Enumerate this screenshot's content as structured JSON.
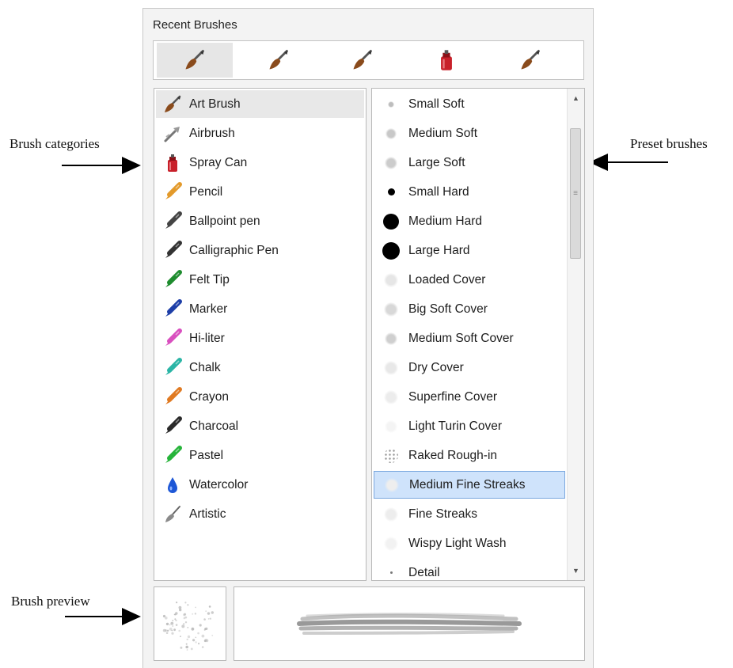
{
  "annotations": {
    "categories": "Brush categories",
    "presets": "Preset brushes",
    "preview": "Brush preview"
  },
  "recent": {
    "title": "Recent Brushes",
    "items": [
      {
        "icon": "art-brush-icon",
        "active": true
      },
      {
        "icon": "art-brush-icon"
      },
      {
        "icon": "art-brush-icon"
      },
      {
        "icon": "spray-can-icon"
      },
      {
        "icon": "art-brush-icon"
      }
    ]
  },
  "categories": {
    "selected": "Art Brush",
    "items": [
      {
        "label": "Art Brush",
        "icon": "art-brush-icon",
        "color": "#8a4b1c"
      },
      {
        "label": "Airbrush",
        "icon": "airbrush-icon",
        "color": "#777777"
      },
      {
        "label": "Spray Can",
        "icon": "spray-can-icon",
        "color": "#c8202a"
      },
      {
        "label": "Pencil",
        "icon": "pencil-icon",
        "color": "#e39a2b"
      },
      {
        "label": "Ballpoint pen",
        "icon": "ballpoint-pen-icon",
        "color": "#444444"
      },
      {
        "label": "Calligraphic Pen",
        "icon": "calligraphic-pen-icon",
        "color": "#333333"
      },
      {
        "label": "Felt Tip",
        "icon": "felt-tip-icon",
        "color": "#1e8c2e"
      },
      {
        "label": "Marker",
        "icon": "marker-icon",
        "color": "#1e3fa8"
      },
      {
        "label": "Hi-liter",
        "icon": "hi-liter-icon",
        "color": "#d94fbf"
      },
      {
        "label": "Chalk",
        "icon": "chalk-icon",
        "color": "#2bb5a6"
      },
      {
        "label": "Crayon",
        "icon": "crayon-icon",
        "color": "#e07a22"
      },
      {
        "label": "Charcoal",
        "icon": "charcoal-icon",
        "color": "#2a2a2a"
      },
      {
        "label": "Pastel",
        "icon": "pastel-icon",
        "color": "#26b43a"
      },
      {
        "label": "Watercolor",
        "icon": "watercolor-icon",
        "color": "#1d57d6"
      },
      {
        "label": "Artistic",
        "icon": "artistic-icon",
        "color": "#8a8a8a"
      }
    ]
  },
  "presets": {
    "selected": "Medium Fine Streaks",
    "items": [
      {
        "label": "Small Soft",
        "icon": "small-soft-dab-icon",
        "color": "#bdbdbd"
      },
      {
        "label": "Medium Soft",
        "icon": "medium-soft-dab-icon",
        "color": "#c8c8c8"
      },
      {
        "label": "Large Soft",
        "icon": "large-soft-dab-icon",
        "color": "#cccccc"
      },
      {
        "label": "Small Hard",
        "icon": "small-hard-dab-icon",
        "color": "#000000"
      },
      {
        "label": "Medium Hard",
        "icon": "medium-hard-dab-icon",
        "color": "#000000"
      },
      {
        "label": "Large Hard",
        "icon": "large-hard-dab-icon",
        "color": "#000000"
      },
      {
        "label": "Loaded Cover",
        "icon": "loaded-cover-dab-icon",
        "color": "#e6e6e6"
      },
      {
        "label": "Big Soft Cover",
        "icon": "big-soft-cover-dab-icon",
        "color": "#d8d8d8"
      },
      {
        "label": "Medium Soft Cover",
        "icon": "medium-soft-cover-dab-icon",
        "color": "#cfcfcf"
      },
      {
        "label": "Dry Cover",
        "icon": "dry-cover-dab-icon",
        "color": "#e8e8e8"
      },
      {
        "label": "Superfine Cover",
        "icon": "superfine-cover-dab-icon",
        "color": "#ececec"
      },
      {
        "label": "Light Turin Cover",
        "icon": "light-turin-cover-dab-icon",
        "color": "#f4f4f4"
      },
      {
        "label": "Raked Rough-in",
        "icon": "raked-rough-in-dab-icon",
        "color": "#bbbbbb"
      },
      {
        "label": "Medium Fine Streaks",
        "icon": "medium-fine-streaks-dab-icon",
        "color": "#eeeeee"
      },
      {
        "label": "Fine Streaks",
        "icon": "fine-streaks-dab-icon",
        "color": "#ededed"
      },
      {
        "label": "Wispy Light Wash",
        "icon": "wispy-light-wash-dab-icon",
        "color": "#f2f2f2"
      },
      {
        "label": "Detail",
        "icon": "detail-dab-icon",
        "color": "#777777"
      }
    ]
  },
  "scrollbar": {
    "up_icon": "scroll-up-icon",
    "down_icon": "scroll-down-icon",
    "thumb_grip": "≡"
  },
  "preview": {
    "dab_icon": "brush-dab-preview",
    "stroke_icon": "brush-stroke-preview"
  }
}
